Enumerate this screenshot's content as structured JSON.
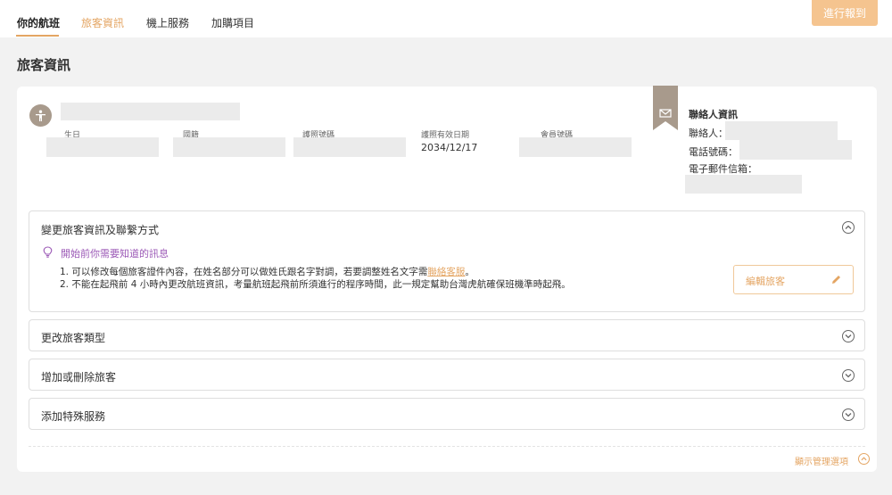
{
  "tabs": [
    {
      "label": "你的航班"
    },
    {
      "label": "旅客資訊"
    },
    {
      "label": "機上服務"
    },
    {
      "label": "加購項目"
    }
  ],
  "checkin_button": "進行報到",
  "page_title": "旅客資訊",
  "passenger": {
    "fields": [
      {
        "label": "生日",
        "value": ""
      },
      {
        "label": "國籍",
        "value": ""
      },
      {
        "label": "護照號碼",
        "value": ""
      },
      {
        "label": "護照有效日期",
        "value": "2034/12/17"
      },
      {
        "label": "會員號碼",
        "value": ""
      }
    ]
  },
  "contact": {
    "title": "聯絡人資訊",
    "name_label": "聯絡人：",
    "phone_label": "電話號碼：",
    "email_label": "電子郵件信箱："
  },
  "panels": {
    "change_info": {
      "title": "變更旅客資訊及聯繫方式",
      "notice_title": "開始前你需要知道的訊息",
      "line1_prefix": "1. 可以修改每個旅客證件內容，在姓名部分可以做姓氏跟名字對調，若要調整姓名文字需",
      "line1_link": "聯絡客服",
      "line1_suffix": "。",
      "line2": "2. 不能在起飛前 4 小時內更改航班資訊，考量航班起飛前所須進行的程序時間，此一規定幫助台灣虎航確保班機準時起飛。",
      "edit_button": "編輯旅客"
    },
    "change_type": {
      "title": "更改旅客類型"
    },
    "add_remove": {
      "title": "增加或刪除旅客"
    },
    "special_service": {
      "title": "添加特殊服務"
    }
  },
  "manage_toggle": "顯示管理選項",
  "colors": {
    "accent": "#e4a563",
    "checkin_bg": "#f5c48f",
    "notice": "#9b59b6",
    "ribbon": "#a89a8c"
  }
}
